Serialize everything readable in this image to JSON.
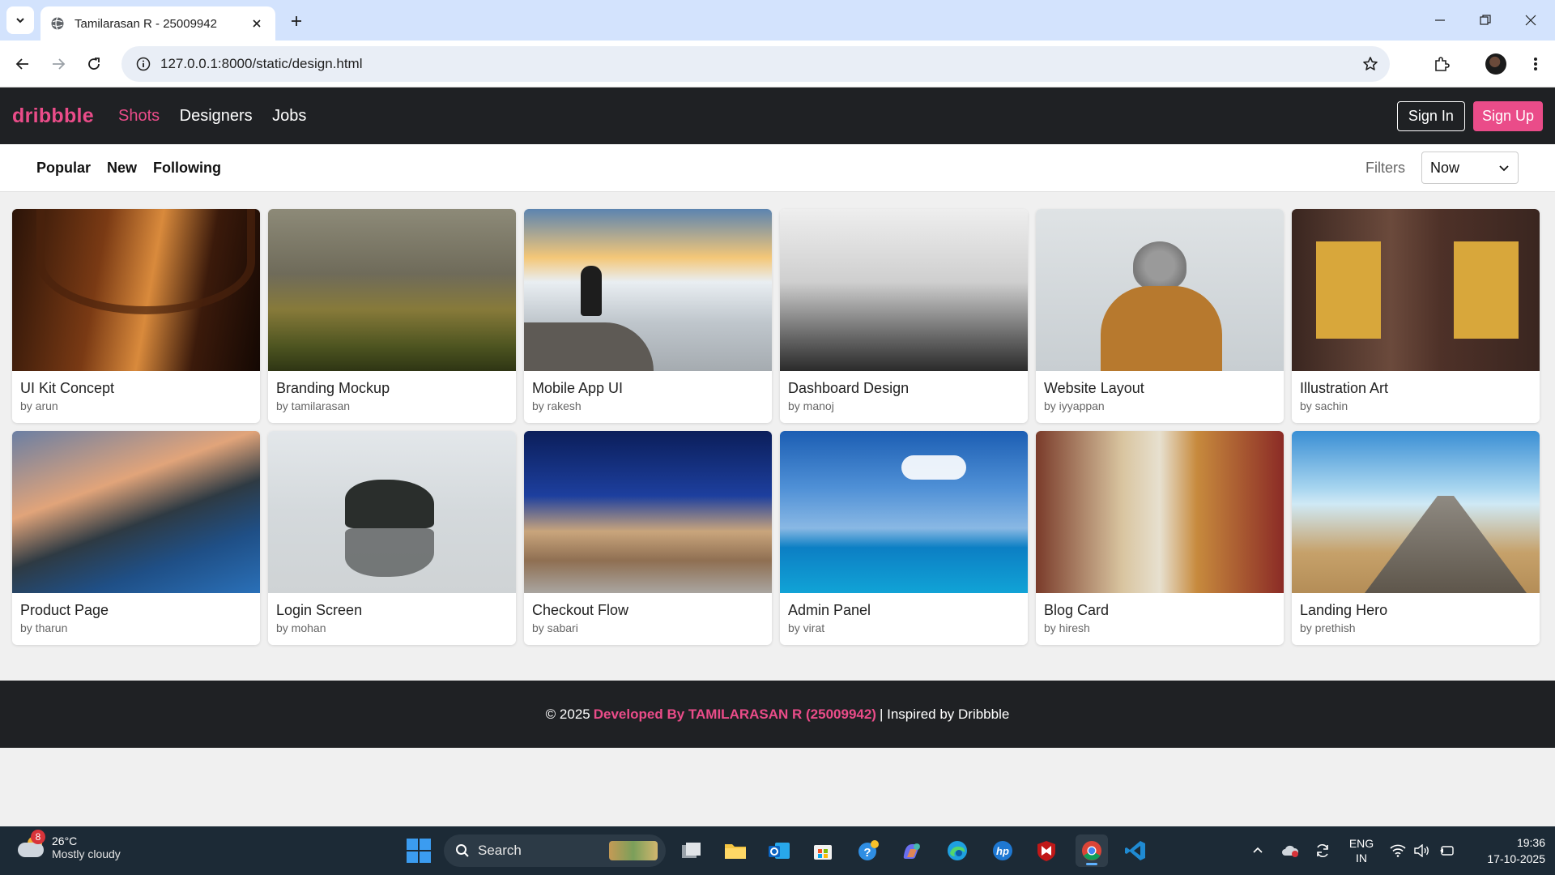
{
  "browser": {
    "tab_title": "Tamilarasan R - 25009942",
    "url": "127.0.0.1:8000/static/design.html"
  },
  "site": {
    "logo": "dribbble",
    "nav": [
      "Shots",
      "Designers",
      "Jobs"
    ],
    "active_nav": "Shots",
    "signin_label": "Sign In",
    "signup_label": "Sign Up",
    "accent_color": "#ea4c89",
    "header_bg": "#1f2124"
  },
  "subnav": {
    "tabs": [
      "Popular",
      "New",
      "Following"
    ],
    "filters_label": "Filters",
    "timeframe_value": "Now"
  },
  "shots": [
    {
      "title": "UI Kit Concept",
      "author": "by arun"
    },
    {
      "title": "Branding Mockup",
      "author": "by tamilarasan"
    },
    {
      "title": "Mobile App UI",
      "author": "by rakesh"
    },
    {
      "title": "Dashboard Design",
      "author": "by manoj"
    },
    {
      "title": "Website Layout",
      "author": "by iyyappan"
    },
    {
      "title": "Illustration Art",
      "author": "by sachin"
    },
    {
      "title": "Product Page",
      "author": "by tharun"
    },
    {
      "title": "Login Screen",
      "author": "by mohan"
    },
    {
      "title": "Checkout Flow",
      "author": "by sabari"
    },
    {
      "title": "Admin Panel",
      "author": "by virat"
    },
    {
      "title": "Blog Card",
      "author": "by hiresh"
    },
    {
      "title": "Landing Hero",
      "author": "by prethish"
    }
  ],
  "footer": {
    "prefix": "© 2025",
    "developer": "Developed By TAMILARASAN R (25009942)",
    "suffix": "| Inspired by Dribbble"
  },
  "taskbar": {
    "weather_badge": "8",
    "temperature": "26°C",
    "condition": "Mostly cloudy",
    "search_placeholder": "Search",
    "language_line1": "ENG",
    "language_line2": "IN",
    "time": "19:36",
    "date": "17-10-2025"
  }
}
